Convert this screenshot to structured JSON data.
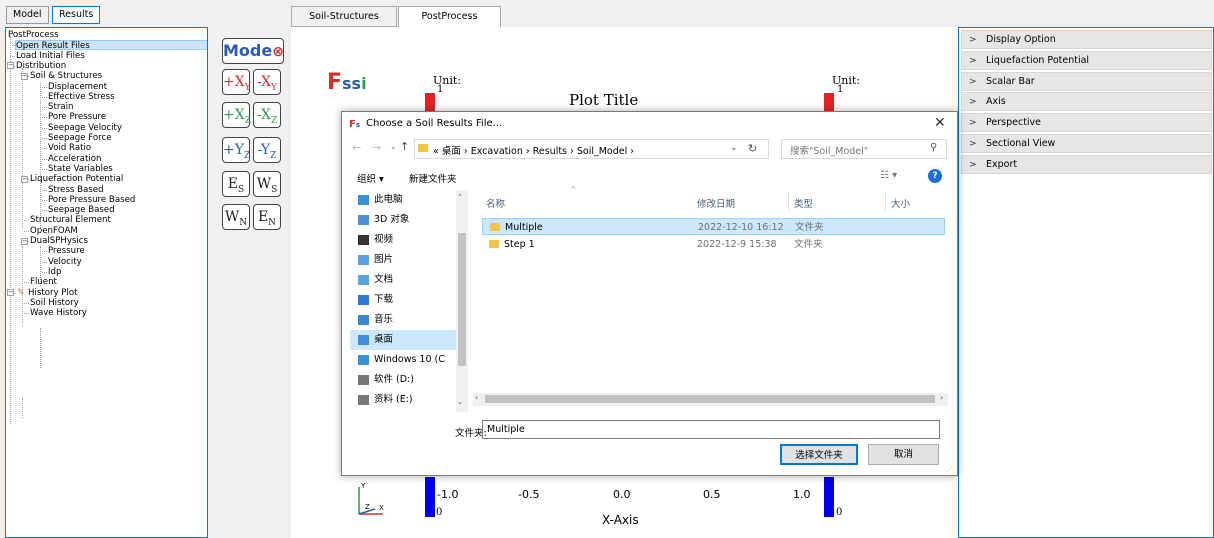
{
  "left_tabs": [
    "Model",
    "Results"
  ],
  "tree": {
    "items": [
      {
        "label": "PostProcess",
        "level": 0,
        "expander": ""
      },
      {
        "label": "Open Result Files",
        "level": 1,
        "selected": true
      },
      {
        "label": "Load Initial Files",
        "level": 1
      },
      {
        "label": "Distribution",
        "level": 1,
        "expander": "-"
      },
      {
        "label": "Soil & Structures",
        "level": 2,
        "expander": "-"
      },
      {
        "label": "Displacement",
        "level": 3
      },
      {
        "label": "Effective Stress",
        "level": 3
      },
      {
        "label": "Strain",
        "level": 3
      },
      {
        "label": "Pore Pressure",
        "level": 3
      },
      {
        "label": "Seepage Velocity",
        "level": 3
      },
      {
        "label": "Seepage Force",
        "level": 3
      },
      {
        "label": "Void Ratio",
        "level": 3
      },
      {
        "label": "Acceleration",
        "level": 3
      },
      {
        "label": "State Variables",
        "level": 3
      },
      {
        "label": "Liquefaction Potential",
        "level": 2,
        "expander": "-"
      },
      {
        "label": "Stress Based",
        "level": 3
      },
      {
        "label": "Pore Pressure Based",
        "level": 3
      },
      {
        "label": "Seepage Based",
        "level": 3
      },
      {
        "label": "Structural Element",
        "level": 2
      },
      {
        "label": "OpenFOAM",
        "level": 2
      },
      {
        "label": "DualSPHysics",
        "level": 2,
        "expander": "-"
      },
      {
        "label": "Pressure",
        "level": 3
      },
      {
        "label": "Velocity",
        "level": 3
      },
      {
        "label": "Idp",
        "level": 3
      },
      {
        "label": "Fluent",
        "level": 2
      },
      {
        "label": "History Plot",
        "level": 1,
        "expander": "-",
        "icon": "pencil-icon"
      },
      {
        "label": "Soil History",
        "level": 2
      },
      {
        "label": "Wave History",
        "level": 2
      }
    ]
  },
  "toolbar": {
    "mode_label": "Mode",
    "buttons": [
      {
        "name": "plus-x-icon",
        "main": "+X",
        "sub": "Y",
        "color": "#d32f2f"
      },
      {
        "name": "minus-x-icon",
        "main": "-X",
        "sub": "Y",
        "color": "#d32f2f"
      },
      {
        "name": "plus-x-z-icon",
        "main": "+X",
        "sub": "Z",
        "color": "#2e9b4e"
      },
      {
        "name": "minus-x-z-icon",
        "main": "-X",
        "sub": "Z",
        "color": "#2e9b4e"
      },
      {
        "name": "plus-y-icon",
        "main": "+Y",
        "sub": "Z",
        "color": "#2a5db0"
      },
      {
        "name": "minus-y-icon",
        "main": "-Y",
        "sub": "Z",
        "color": "#2a5db0"
      },
      {
        "name": "east-south-icon",
        "main": "E",
        "sub": "S",
        "color": "#222"
      },
      {
        "name": "west-south-icon",
        "main": "W",
        "sub": "S",
        "color": "#222"
      },
      {
        "name": "west-north-icon",
        "main": "W",
        "sub": "N",
        "color": "#222"
      },
      {
        "name": "east-north-icon",
        "main": "E",
        "sub": "N",
        "color": "#222"
      }
    ]
  },
  "plot_tabs": [
    "Soil-Structures",
    "PostProcess"
  ],
  "plot": {
    "logo": "FSSI",
    "unit_left": "Unit:",
    "unit_right": "Unit:",
    "unit_value": "1",
    "title": "Plot Title",
    "bar_bottom": "0",
    "x_ticks": [
      "-1.0",
      "-0.5",
      "0.0",
      "0.5",
      "1.0"
    ],
    "x_label": "X-Axis",
    "axis_y": "Y",
    "axis_z": "Z",
    "axis_x": "X"
  },
  "right_panel": {
    "items": [
      "Display Option",
      "Liquefaction Potential",
      "Scalar Bar",
      "Axis",
      "Perspective",
      "Sectional View",
      "Export"
    ]
  },
  "dialog": {
    "title": "Choose a Soil Results File...",
    "breadcrumb": [
      "«",
      "桌面",
      "Excavation",
      "Results",
      "Soil_Model"
    ],
    "search_placeholder": "搜索\"Soil_Model\"",
    "organize": "组织 ▾",
    "new_folder": "新建文件夹",
    "nav_items": [
      {
        "label": "此电脑",
        "icon": "computer-icon",
        "color": "#3c8fdd"
      },
      {
        "label": "3D 对象",
        "icon": "3d-objects-icon",
        "color": "#4a90d9"
      },
      {
        "label": "视频",
        "icon": "video-icon",
        "color": "#333"
      },
      {
        "label": "图片",
        "icon": "pictures-icon",
        "color": "#5ba3e0"
      },
      {
        "label": "文档",
        "icon": "documents-icon",
        "color": "#5ba3e0"
      },
      {
        "label": "下载",
        "icon": "downloads-icon",
        "color": "#2e7bd6"
      },
      {
        "label": "音乐",
        "icon": "music-icon",
        "color": "#3b84d6"
      },
      {
        "label": "桌面",
        "icon": "desktop-icon",
        "color": "#3c8fdd",
        "selected": true
      },
      {
        "label": "Windows 10 (C",
        "icon": "drive-c-icon",
        "color": "#3c8fdd"
      },
      {
        "label": "软件 (D:)",
        "icon": "drive-d-icon",
        "color": "#777"
      },
      {
        "label": "资料 (E:)",
        "icon": "drive-e-icon",
        "color": "#777"
      }
    ],
    "columns": [
      "名称",
      "修改日期",
      "类型",
      "大小"
    ],
    "files": [
      {
        "name": "Multiple",
        "date": "2022-12-10 16:12",
        "type": "文件夹",
        "selected": true
      },
      {
        "name": "Step 1",
        "date": "2022-12-9 15:38",
        "type": "文件夹"
      }
    ],
    "folder_label": "文件夹:",
    "folder_value": "Multiple",
    "select_button": "选择文件夹",
    "cancel_button": "取消"
  }
}
